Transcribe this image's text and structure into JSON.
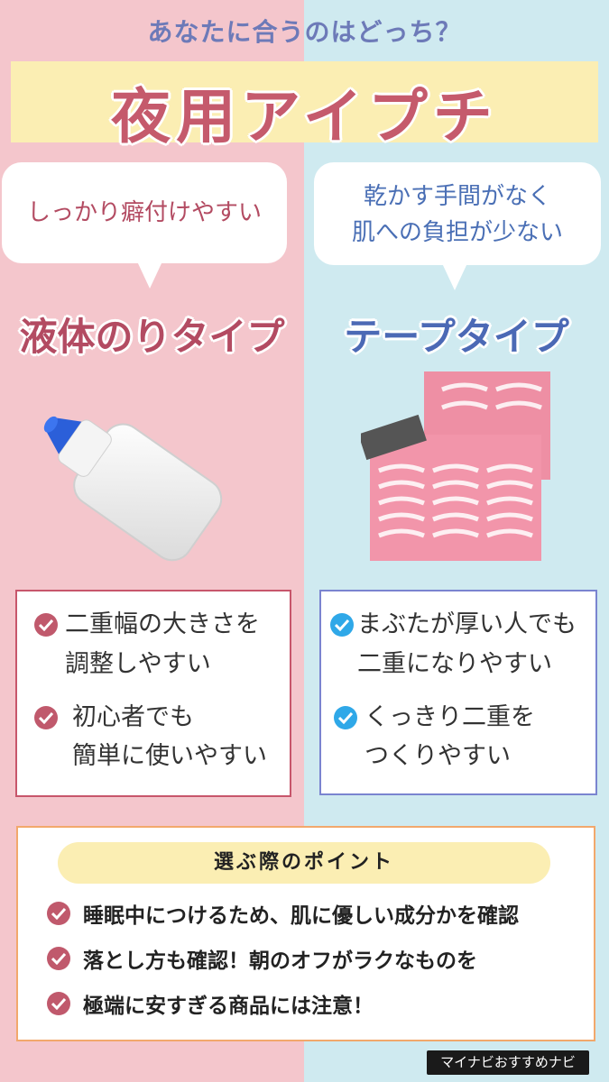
{
  "header": {
    "subtitle": "あなたに合うのはどっち？",
    "title": "夜用アイプチ"
  },
  "left": {
    "bubble_line1": "しっかり癖付けやすい",
    "type_title": "液体のりタイプ",
    "image_alt": "液体のり",
    "features": [
      {
        "line1": "二重幅の大きさを",
        "line2": "調整しやすい"
      },
      {
        "line1": "初心者でも",
        "line2": "簡単に使いやすい"
      }
    ]
  },
  "right": {
    "bubble_line1": "乾かす手間がなく",
    "bubble_line2": "肌への負担が少ない",
    "type_title": "テープタイプ",
    "image_alt": "アイテープ",
    "features": [
      {
        "line1": "まぶたが厚い人でも",
        "line2": "二重になりやすい"
      },
      {
        "line1": "くっきり二重を",
        "line2": "つくりやすい"
      }
    ]
  },
  "points": {
    "heading": "選ぶ際のポイント",
    "items": [
      "睡眠中につけるため、肌に優しい成分かを確認",
      "落とし方も確認！朝のオフがラクなものを",
      "極端に安すぎる商品には注意！"
    ]
  },
  "footer": {
    "brand": "マイナビおすすめナビ"
  },
  "colors": {
    "left_bg": "#f4c6cc",
    "right_bg": "#cfeaf0",
    "pink_accent": "#c0596c",
    "blue_accent": "#2fa8e8",
    "title_band": "#fbeeb3"
  },
  "icons": [
    "check-icon"
  ]
}
